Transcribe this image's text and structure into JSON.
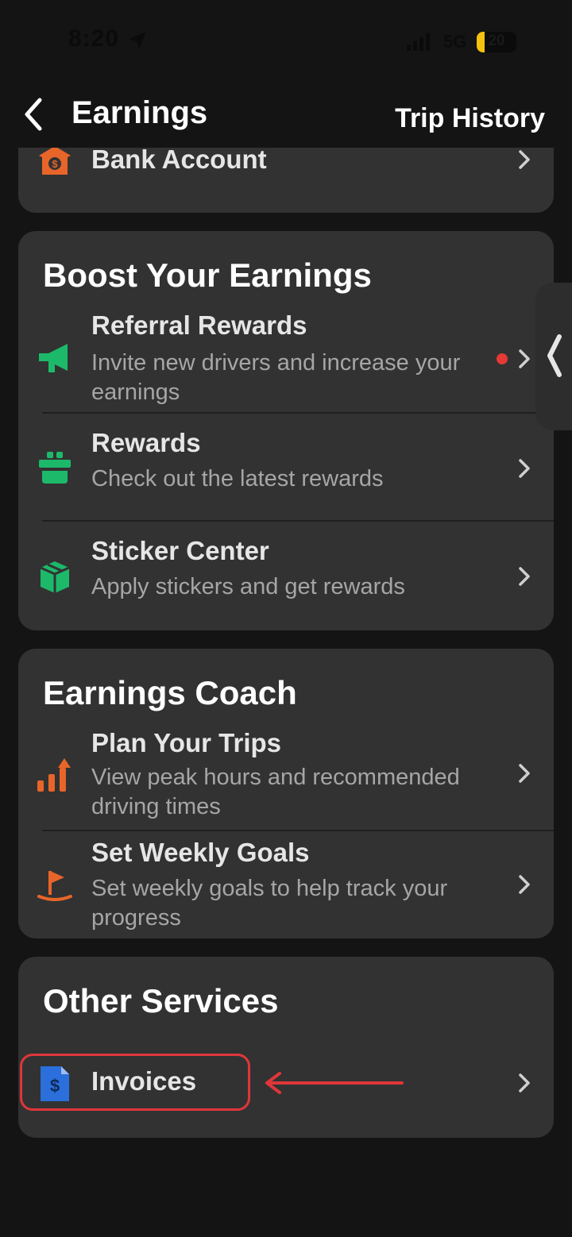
{
  "status_bar": {
    "time": "8:20",
    "network": "5G",
    "battery": "20",
    "battery_level": 0.2
  },
  "header": {
    "title": "Earnings",
    "right_link": "Trip History"
  },
  "bank_card": {
    "item": {
      "title": "Bank Account",
      "icon": "bank-icon"
    }
  },
  "boost": {
    "title": "Boost Your Earnings",
    "items": [
      {
        "title": "Referral Rewards",
        "subtitle": "Invite new drivers and increase your earnings",
        "icon": "megaphone-icon",
        "has_dot": true
      },
      {
        "title": "Rewards",
        "subtitle": "Check out the latest rewards",
        "icon": "gift-icon"
      },
      {
        "title": "Sticker Center",
        "subtitle": "Apply stickers and get rewards",
        "icon": "sticker-box-icon"
      }
    ]
  },
  "coach": {
    "title": "Earnings Coach",
    "items": [
      {
        "title": "Plan Your Trips",
        "subtitle": "View peak hours and recommended driving times",
        "icon": "trending-bars-icon"
      },
      {
        "title": "Set Weekly Goals",
        "subtitle": "Set weekly goals to help track your progress",
        "icon": "goal-flag-icon"
      }
    ]
  },
  "other": {
    "title": "Other Services",
    "items": [
      {
        "title": "Invoices",
        "icon": "invoice-dollar-icon"
      }
    ]
  },
  "colors": {
    "accent_orange": "#e8652a",
    "accent_green": "#1db96a",
    "accent_blue": "#2a6fdb",
    "annotation_red": "#e0363a"
  }
}
